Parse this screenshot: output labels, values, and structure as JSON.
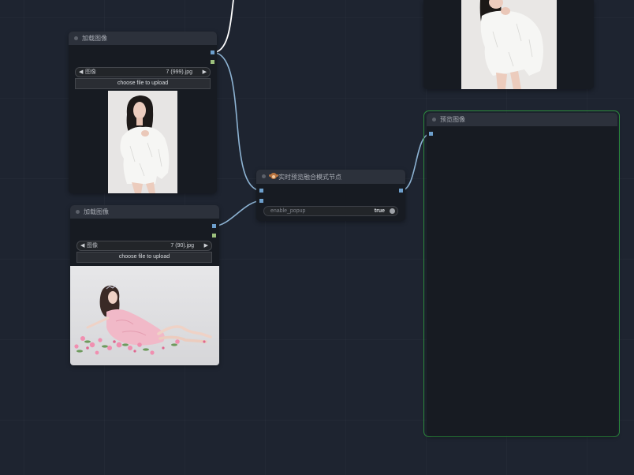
{
  "colors": {
    "canvas_background": "#1e2430",
    "image_slot": "#6d9fcc",
    "mask_slot": "#9cc07d",
    "link": "#8db3d3",
    "link_highlighted": "#ffffff",
    "selected_outline": "#2e8f3e"
  },
  "load_image_nodes": [
    {
      "title": "加载图像",
      "combo": {
        "arrow_left": "◀",
        "label": "图像",
        "value": "7 (999).jpg",
        "arrow_right": "▶"
      },
      "upload_button": "choose file to upload"
    },
    {
      "title": "加载图像",
      "combo": {
        "arrow_left": "◀",
        "label": "图像",
        "value": "7 (90).jpg",
        "arrow_right": "▶"
      },
      "upload_button": "choose file to upload"
    }
  ],
  "blend_node": {
    "icon": "monkey-icon",
    "title": "实时预览融合模式节点",
    "toggle": {
      "label": "enable_popup",
      "value": "true"
    }
  },
  "preview_node": {
    "title": "预览图像"
  }
}
